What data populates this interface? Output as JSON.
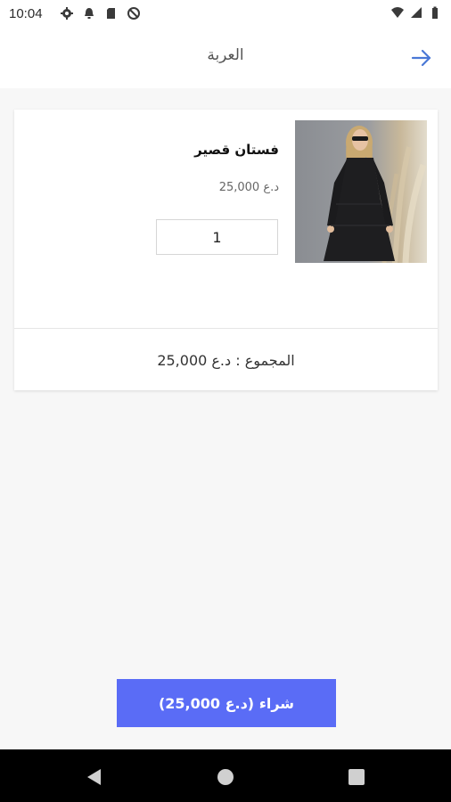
{
  "status_bar": {
    "time": "10:04",
    "left_icons": [
      "settings-icon",
      "notification-bell-icon",
      "sd-card-icon",
      "do-not-disturb-icon"
    ],
    "right_icons": [
      "wifi-icon",
      "signal-icon",
      "battery-icon"
    ]
  },
  "app_bar": {
    "title": "العربة",
    "back_icon": "arrow-right-icon"
  },
  "cart": {
    "items": [
      {
        "name": "فستان قصير",
        "price": "د.ع 25,000",
        "quantity": "1",
        "image": "black-dress-photo"
      }
    ],
    "total_label": "المجموع : د.ع 25,000"
  },
  "buy_button": {
    "label": "شراء (د.ع 25,000)"
  },
  "colors": {
    "accent": "#5a6cf6",
    "back_arrow": "#4a78d6",
    "background": "#f7f7f7"
  }
}
